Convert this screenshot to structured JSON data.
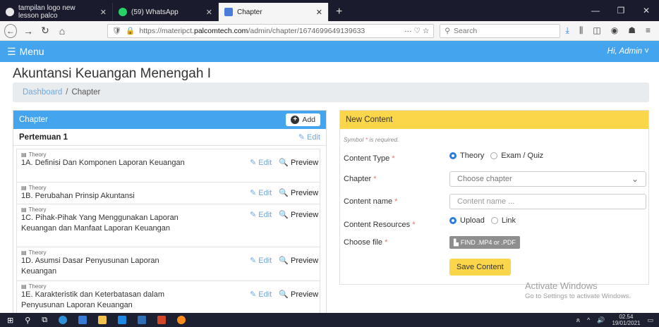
{
  "browser": {
    "tabs": [
      {
        "label": "tampilan logo new lesson palco",
        "color": "#e8e8e8",
        "active": false
      },
      {
        "label": "(59) WhatsApp",
        "color": "#25d366",
        "active": false
      },
      {
        "label": "Chapter",
        "color": "#4a7cdc",
        "active": true
      }
    ],
    "new_tab": "+",
    "url_prefix": "https://materipct.",
    "url_host": "palcomtech.com",
    "url_path": "/admin/chapter/1674699649139633",
    "url_tail_icons": "··· ♡ ☆",
    "search_placeholder": "Search"
  },
  "app": {
    "menu_label": "Menu",
    "user_greeting": "Hi, Admin",
    "page_title": "Akuntansi Keuangan Menengah I",
    "breadcrumb": {
      "home": "Dashboard",
      "sep": "/",
      "current": "Chapter"
    }
  },
  "chapter_panel": {
    "header": "Chapter",
    "add_label": "Add",
    "meeting_title": "Pertemuan 1",
    "meeting_edit": "Edit",
    "edit_label": "Edit",
    "preview_label": "Preview",
    "items": [
      {
        "type": "Theory",
        "title": "1A. Definisi Dan Komponen Laporan Keuangan"
      },
      {
        "type": "Theory",
        "title": "1B. Perubahan Prinsip Akuntansi"
      },
      {
        "type": "Theory",
        "title": "1C. Pihak-Pihak Yang Menggunakan Laporan Keuangan dan Manfaat Laporan Keuangan"
      },
      {
        "type": "Theory",
        "title": "1D. Asumsi Dasar Penyusunan Laporan Keuangan"
      },
      {
        "type": "Theory",
        "title": "1E. Karakteristik dan Keterbatasan dalam Penyusunan Laporan Keuangan"
      }
    ]
  },
  "content_form": {
    "header": "New Content",
    "required_note": "Symbol",
    "required_note_tail": "is required.",
    "content_type_label": "Content Type",
    "content_type_options": [
      "Theory",
      "Exam / Quiz"
    ],
    "chapter_label": "Chapter",
    "chapter_placeholder": "Choose chapter",
    "content_name_label": "Content name",
    "content_name_placeholder": "Content name ...",
    "resources_label": "Content Resources",
    "resources_options": [
      "Upload",
      "Link"
    ],
    "file_label": "Choose file",
    "file_button": "FIND .MP4 or .PDF",
    "save_button": "Save Content"
  },
  "watermark": {
    "line1": "Activate Windows",
    "line2": "Go to Settings to activate Windows."
  },
  "taskbar": {
    "time": "02.54",
    "date": "19/01/2021"
  },
  "colors": {
    "primary": "#44a4ee",
    "accent": "#fbd64a",
    "link": "#6fa8dc"
  }
}
